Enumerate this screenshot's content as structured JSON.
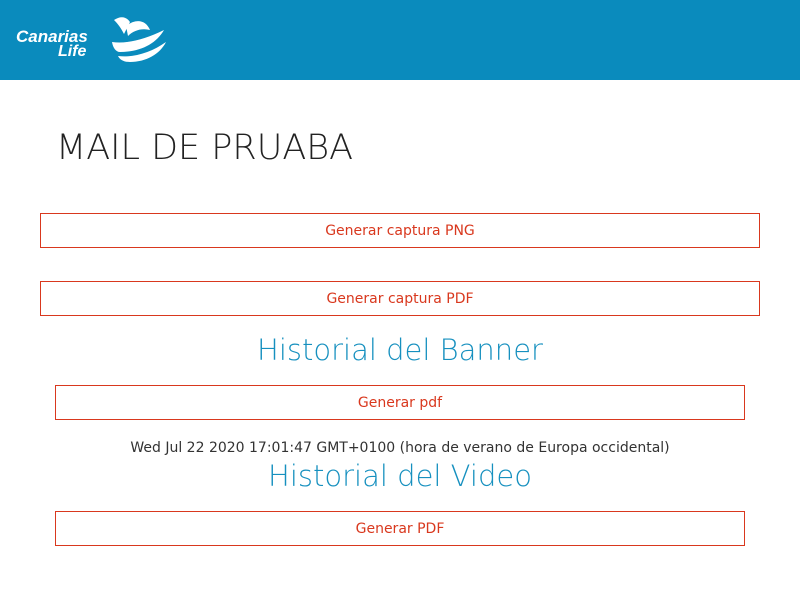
{
  "header": {
    "logo_line1": "Canarias",
    "logo_line2": "Life",
    "logo_icon": "canarias-life-logo-icon",
    "background_color": "#0a8bbd"
  },
  "main": {
    "title": "MAIL DE PRUABA",
    "png_button_label": "Generar captura PNG",
    "pdf_button_label": "Generar captura PDF"
  },
  "banner_history": {
    "title": "Historial del Banner",
    "button_label": "Generar pdf",
    "timestamp": "Wed Jul 22 2020 17:01:47 GMT+0100 (hora de verano de Europa occidental)"
  },
  "video_history": {
    "title": "Historial del Video",
    "button_label": "Generar PDF"
  },
  "colors": {
    "accent": "#d9381e",
    "heading": "#1690bf"
  }
}
